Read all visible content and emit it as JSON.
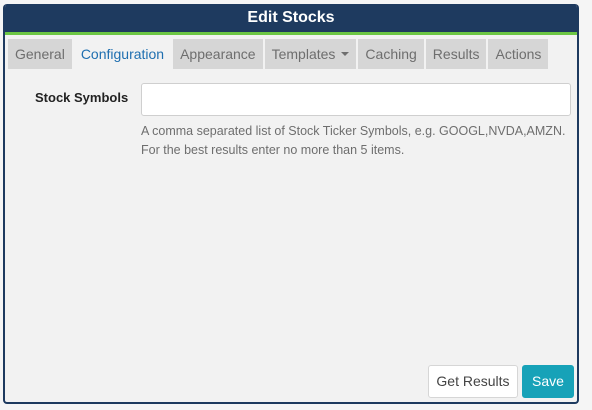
{
  "dialog": {
    "title": "Edit Stocks"
  },
  "tabs": [
    {
      "label": "General"
    },
    {
      "label": "Configuration"
    },
    {
      "label": "Appearance"
    },
    {
      "label": "Templates"
    },
    {
      "label": "Caching"
    },
    {
      "label": "Results"
    },
    {
      "label": "Actions"
    }
  ],
  "active_tab": "Configuration",
  "form": {
    "stock_symbols_label": "Stock Symbols",
    "stock_symbols_value": "",
    "help_line1": "A comma separated list of Stock Ticker Symbols, e.g. GOOGL,NVDA,AMZN.",
    "help_line2": "For the best results enter no more than 5 items."
  },
  "buttons": {
    "get_results": "Get Results",
    "save": "Save"
  },
  "colors": {
    "titlebar": "#1e3a5f",
    "accent_line": "#6cc644",
    "active_tab_text": "#1f6fb0",
    "save_button": "#17a2b8"
  }
}
